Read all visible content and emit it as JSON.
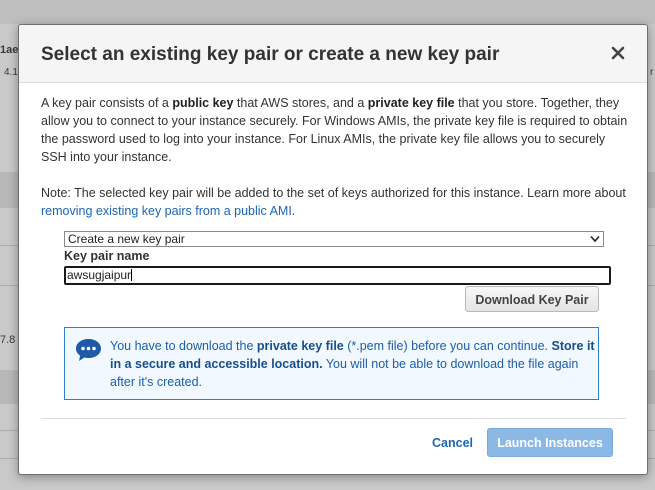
{
  "background": {
    "fragments": [
      "1ae",
      "4.1",
      "7.8",
      "r"
    ]
  },
  "modal": {
    "title": "Select an existing key pair or create a new key pair",
    "close_icon": "close-icon",
    "description": {
      "p1_a": "A key pair consists of a ",
      "p1_b": "public key",
      "p1_c": " that AWS stores, and a ",
      "p1_d": "private key file",
      "p1_e": " that you store. Together, they allow you to connect to your instance securely. For Windows AMIs, the private key file is required to obtain the password used to log into your instance. For Linux AMIs, the private key file allows you to securely SSH into your instance."
    },
    "note": {
      "text": "Note: The selected key pair will be added to the set of keys authorized for this instance. Learn more about ",
      "link": "removing existing key pairs from a public AMI",
      "end": "."
    },
    "key_pair_select": {
      "selected": "Create a new key pair"
    },
    "key_pair_name": {
      "label": "Key pair name",
      "value": "awsugjaipur"
    },
    "download_button": "Download Key Pair",
    "info": {
      "icon": "chat-bubble-icon",
      "t1": "You have to download the ",
      "t2": "private key file",
      "t3": " (*.pem file) before you can continue. ",
      "t4": "Store it in a secure and accessible location.",
      "t5": " You will not be able to download the file again after it's created."
    },
    "footer": {
      "cancel": "Cancel",
      "launch": "Launch Instances"
    }
  },
  "colors": {
    "accent_link": "#1b66b3",
    "launch_disabled": "#8cb8e6",
    "info_border": "#2f7fd0"
  }
}
